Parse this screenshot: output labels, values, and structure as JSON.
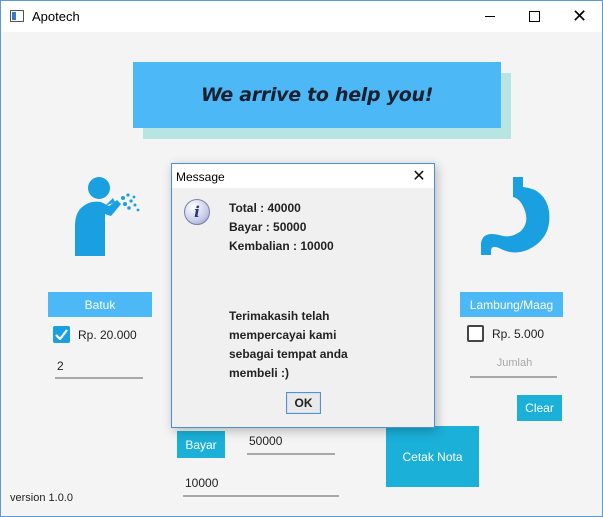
{
  "window": {
    "title": "Apotech",
    "close_glyph": "✕"
  },
  "banner": {
    "text": "We arrive to help you!"
  },
  "products": {
    "batuk": {
      "button_label": "Batuk",
      "price": "Rp. 20.000",
      "checked": true,
      "quantity": "2",
      "icon": "cough-icon"
    },
    "lambung": {
      "button_label": "Lambung/Maag",
      "price": "Rp. 5.000",
      "checked": false,
      "quantity_placeholder": "Jumlah",
      "icon": "stomach-icon"
    }
  },
  "controls": {
    "clear_label": "Clear",
    "bayar_label": "Bayar",
    "bayar_value": "50000",
    "kembalian_value": "10000",
    "cetak_label": "Cetak Nota"
  },
  "footer": {
    "version": "version 1.0.0"
  },
  "dialog": {
    "title": "Message",
    "close_glyph": "✕",
    "icon": "info-icon",
    "icon_glyph": "i",
    "lines": [
      "Total : 40000",
      "Bayar : 50000",
      "Kembalian : 10000",
      "Terimakasih telah",
      "mempercayai kami",
      "sebagai tempat anda",
      "membeli :)"
    ],
    "ok_label": "OK"
  },
  "colors": {
    "accent_blue": "#4cb8f5",
    "accent_teal": "#1ab0d8",
    "banner_shadow": "#b7e6e2",
    "icon_blue": "#1a9fe0"
  }
}
